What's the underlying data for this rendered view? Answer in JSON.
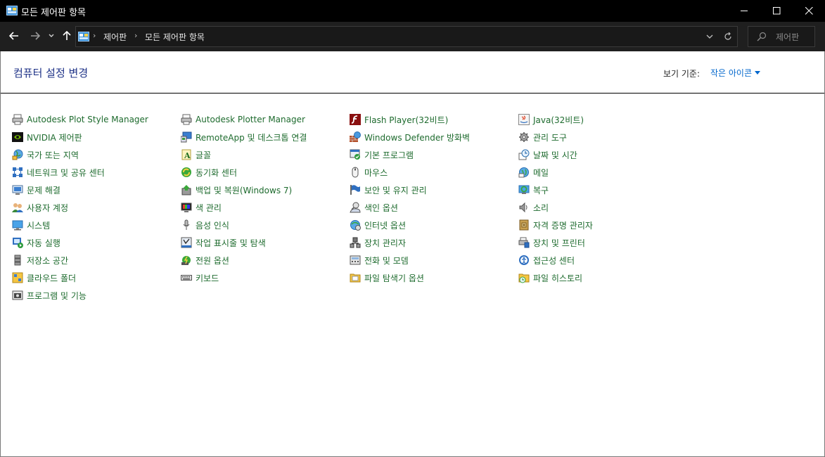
{
  "window": {
    "title": "모든 제어판 항목"
  },
  "address_bar": {
    "breadcrumbs": [
      "제어판",
      "모든 제어판 항목"
    ],
    "search_placeholder": "제어판"
  },
  "header": {
    "page_title": "컴퓨터 설정 변경",
    "view_by_label": "보기 기준:",
    "view_by_value": "작은 아이콘"
  },
  "columns": [
    [
      {
        "label": "Autodesk Plot Style Manager",
        "icon": "printer-style-icon"
      },
      {
        "label": "NVIDIA 제어판",
        "icon": "nvidia-icon"
      },
      {
        "label": "국가 또는 지역",
        "icon": "globe-region-icon"
      },
      {
        "label": "네트워크 및 공유 센터",
        "icon": "network-icon"
      },
      {
        "label": "문제 해결",
        "icon": "troubleshoot-icon"
      },
      {
        "label": "사용자 계정",
        "icon": "users-icon"
      },
      {
        "label": "시스템",
        "icon": "system-icon"
      },
      {
        "label": "자동 실행",
        "icon": "autoplay-icon"
      },
      {
        "label": "저장소 공간",
        "icon": "storage-icon"
      },
      {
        "label": "클라우드 폴더",
        "icon": "cloud-folder-icon"
      },
      {
        "label": "프로그램 및 기능",
        "icon": "programs-icon"
      }
    ],
    [
      {
        "label": "Autodesk Plotter Manager",
        "icon": "plotter-icon"
      },
      {
        "label": "RemoteApp 및 데스크톱 연결",
        "icon": "remoteapp-icon"
      },
      {
        "label": "글꼴",
        "icon": "fonts-icon"
      },
      {
        "label": "동기화 센터",
        "icon": "sync-icon"
      },
      {
        "label": "백업 및 복원(Windows 7)",
        "icon": "backup-icon"
      },
      {
        "label": "색 관리",
        "icon": "color-management-icon"
      },
      {
        "label": "음성 인식",
        "icon": "microphone-icon"
      },
      {
        "label": "작업 표시줄 및 탐색",
        "icon": "taskbar-icon"
      },
      {
        "label": "전원 옵션",
        "icon": "power-icon"
      },
      {
        "label": "키보드",
        "icon": "keyboard-icon"
      }
    ],
    [
      {
        "label": "Flash Player(32비트)",
        "icon": "flash-icon"
      },
      {
        "label": "Windows Defender 방화벽",
        "icon": "firewall-icon"
      },
      {
        "label": "기본 프로그램",
        "icon": "default-programs-icon"
      },
      {
        "label": "마우스",
        "icon": "mouse-icon"
      },
      {
        "label": "보안 및 유지 관리",
        "icon": "flag-icon"
      },
      {
        "label": "색인 옵션",
        "icon": "indexing-icon"
      },
      {
        "label": "인터넷 옵션",
        "icon": "internet-options-icon"
      },
      {
        "label": "장치 관리자",
        "icon": "device-manager-icon"
      },
      {
        "label": "전화 및 모뎀",
        "icon": "phone-modem-icon"
      },
      {
        "label": "파일 탐색기 옵션",
        "icon": "folder-options-icon"
      }
    ],
    [
      {
        "label": "Java(32비트)",
        "icon": "java-icon"
      },
      {
        "label": "관리 도구",
        "icon": "admin-tools-icon"
      },
      {
        "label": "날짜 및 시간",
        "icon": "clock-icon"
      },
      {
        "label": "메일",
        "icon": "mail-icon"
      },
      {
        "label": "복구",
        "icon": "recovery-icon"
      },
      {
        "label": "소리",
        "icon": "speaker-icon"
      },
      {
        "label": "자격 증명 관리자",
        "icon": "credential-icon"
      },
      {
        "label": "장치 및 프린터",
        "icon": "devices-printers-icon"
      },
      {
        "label": "접근성 센터",
        "icon": "accessibility-icon"
      },
      {
        "label": "파일 히스토리",
        "icon": "file-history-icon"
      }
    ]
  ]
}
